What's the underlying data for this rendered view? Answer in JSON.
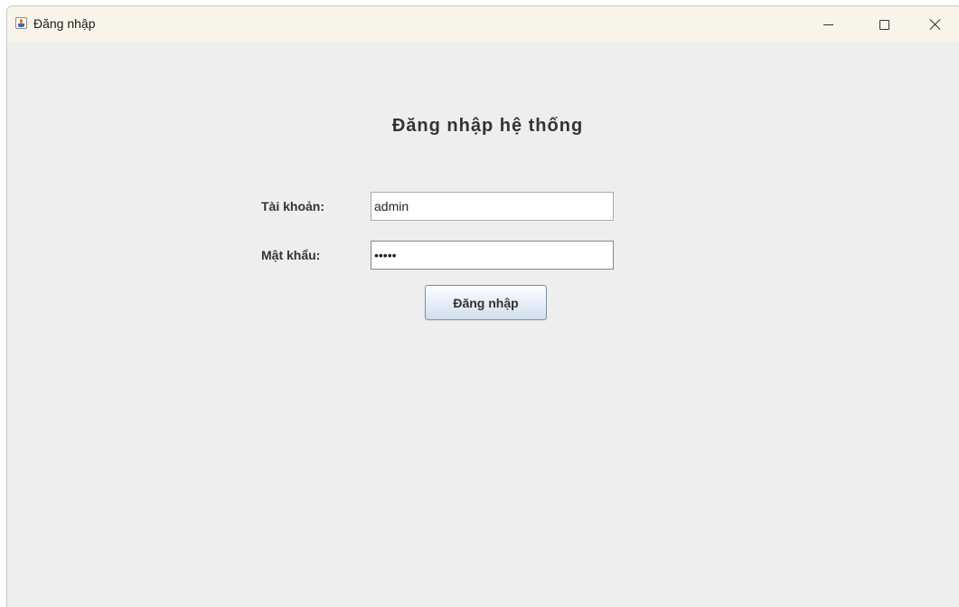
{
  "window": {
    "title": "Đăng nhập",
    "icon": "java-cup-icon",
    "controls": [
      "minimize-icon",
      "maximize-icon",
      "close-icon"
    ]
  },
  "form": {
    "heading": "Đăng nhập hệ thống",
    "username_label": "Tài khoản:",
    "username_value": "admin",
    "password_label": "Mật khẩu:",
    "password_value": "•••••",
    "login_button_label": "Đăng nhập"
  },
  "colors": {
    "titlebar": "#f8f4e9",
    "background": "#eeeeee"
  }
}
